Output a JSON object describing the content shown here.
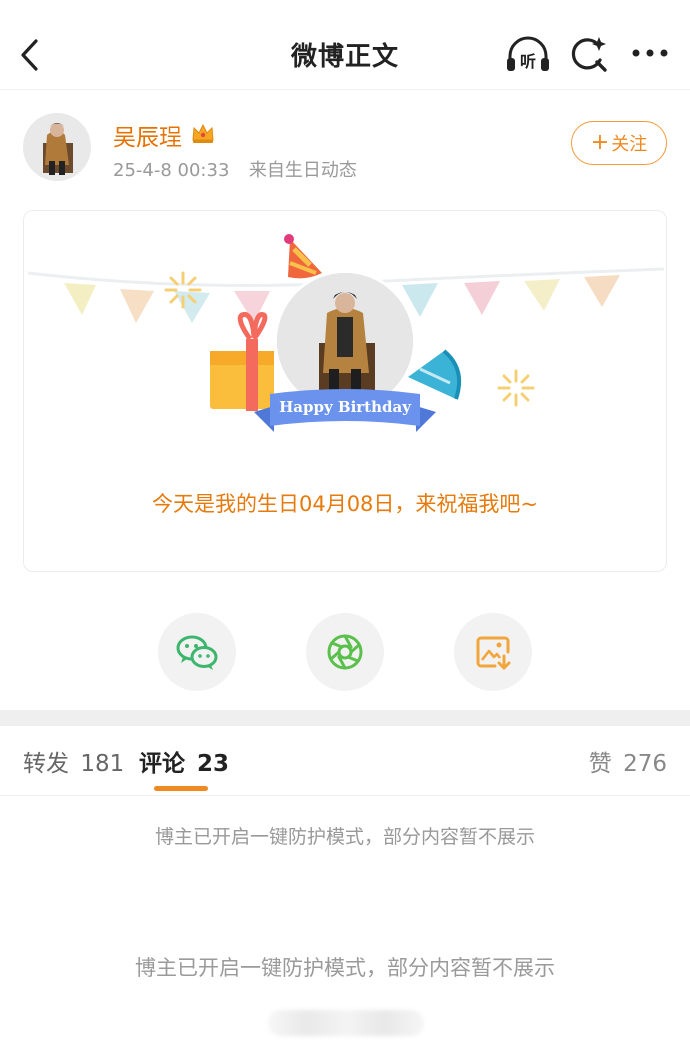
{
  "header": {
    "title": "微博正文",
    "listen_label": "听",
    "icons": [
      "back-arrow-icon",
      "listen-headphones-icon",
      "search-sparkle-icon",
      "more-dots-icon"
    ]
  },
  "post": {
    "author_name": "吴辰珵",
    "badge_icon": "crown-icon",
    "timestamp": "25-4-8 00:33",
    "source": "来自生日动态",
    "follow_label": "关注",
    "follow_plus": "+",
    "card": {
      "ribbon_text": "Happy Birthday",
      "greeting": "今天是我的生日04月08日，来祝福我吧~"
    }
  },
  "share": {
    "icons": [
      "wechat-icon",
      "moments-icon",
      "save-image-icon"
    ]
  },
  "tabs": {
    "repost_label": "转发",
    "repost_count": "181",
    "comments_label": "评论",
    "comments_count": "23",
    "likes_label": "赞",
    "likes_count": "276"
  },
  "notices": {
    "first": "博主已开启一键防护模式，部分内容暂不展示",
    "second": "博主已开启一键防护模式，部分内容暂不展示"
  },
  "colors": {
    "accent": "#f08a20",
    "author_name": "#e67000",
    "muted": "#999999"
  }
}
